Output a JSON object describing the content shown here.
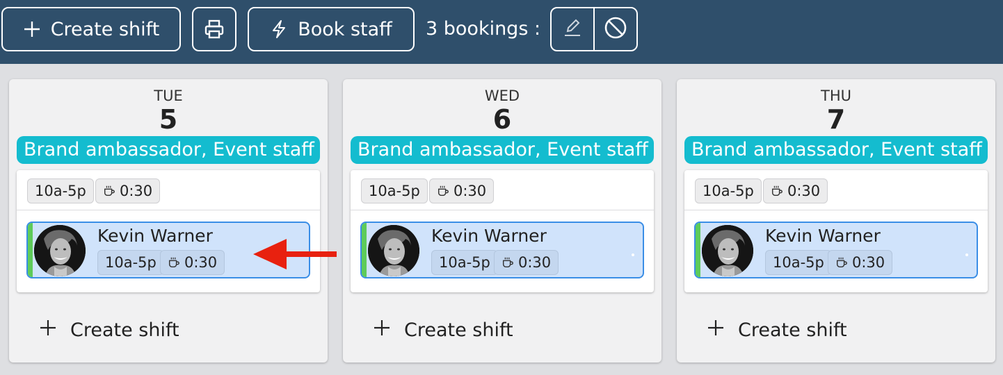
{
  "toolbar": {
    "create_label": "Create shift",
    "book_label": "Book staff",
    "bookings_text": "3 bookings :",
    "icons": [
      "plus-icon",
      "print-icon",
      "lightning-icon",
      "edit-icon",
      "cancel-icon"
    ]
  },
  "colors": {
    "toolbar_bg": "#2f4f6b",
    "role_banner": "#14bccf",
    "booking_bg": "#d0e3fb",
    "booking_border": "#3a8ee6",
    "status_bar": "#5ecb5a",
    "annotation_arrow": "#e8210f"
  },
  "days": [
    {
      "day_name": "TUE",
      "day_num": "5",
      "role": "Brand ambassador, Event staff",
      "shift_time": "10a-5p",
      "shift_break": "0:30",
      "booking": {
        "name": "Kevin Warner",
        "time": "10a-5p",
        "break": "0:30"
      },
      "create_label": "Create shift"
    },
    {
      "day_name": "WED",
      "day_num": "6",
      "role": "Brand ambassador, Event staff",
      "shift_time": "10a-5p",
      "shift_break": "0:30",
      "booking": {
        "name": "Kevin Warner",
        "time": "10a-5p",
        "break": "0:30"
      },
      "create_label": "Create shift"
    },
    {
      "day_name": "THU",
      "day_num": "7",
      "role": "Brand ambassador, Event staff",
      "shift_time": "10a-5p",
      "shift_break": "0:30",
      "booking": {
        "name": "Kevin Warner",
        "time": "10a-5p",
        "break": "0:30"
      },
      "create_label": "Create shift"
    }
  ]
}
